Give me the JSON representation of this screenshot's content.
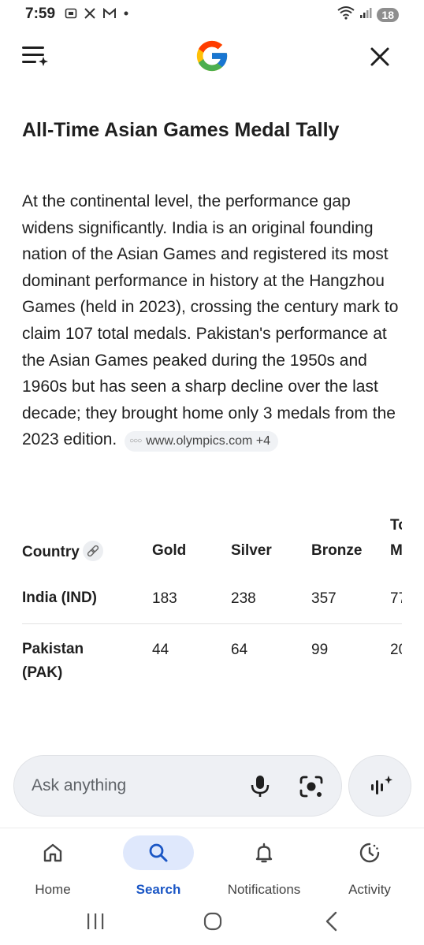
{
  "status_bar": {
    "time": "7:59",
    "battery": "18",
    "left_icons": [
      "gallery-icon",
      "x-icon",
      "gmail-icon",
      "dot-icon"
    ],
    "right_icons": [
      "wifi-icon",
      "signal-icon"
    ]
  },
  "header": {
    "menu_icon": "menu-sparkle-icon",
    "logo": "google-g-logo",
    "close_icon": "close-icon"
  },
  "article": {
    "title": "All-Time Asian Games Medal Tally",
    "body": "At the continental level, the performance gap widens significantly. India is an original founding nation of the Asian Games and registered its most dominant performance in history at the Hangzhou Games (held in 2023), crossing the century mark to claim 107 total medals. Pakistan's performance at the Asian Games peaked during the 1950s and 1960s but has seen a sharp decline over the last decade; they brought home only 3 medals from the 2023 edition.",
    "source_chip": "www.olympics.com +4"
  },
  "table": {
    "headers": {
      "country": "Country",
      "gold": "Gold",
      "silver": "Silver",
      "bronze": "Bronze",
      "total_line1": "To",
      "total_line2": "M"
    },
    "rows": [
      {
        "country": "India (IND)",
        "gold": "183",
        "silver": "238",
        "bronze": "357",
        "total": "77"
      },
      {
        "country": "Pakistan (PAK)",
        "gold": "44",
        "silver": "64",
        "bronze": "99",
        "total": "20"
      }
    ]
  },
  "search": {
    "placeholder": "Ask anything"
  },
  "bottom_nav": {
    "items": [
      {
        "label": "Home",
        "icon": "home-icon",
        "active": false
      },
      {
        "label": "Search",
        "icon": "search-icon",
        "active": true
      },
      {
        "label": "Notifications",
        "icon": "bell-icon",
        "active": false
      },
      {
        "label": "Activity",
        "icon": "activity-icon",
        "active": false
      }
    ]
  },
  "colors": {
    "accent": "#1a56c5",
    "active_pill": "#dfe8fc",
    "search_bg": "#eef0f4"
  }
}
